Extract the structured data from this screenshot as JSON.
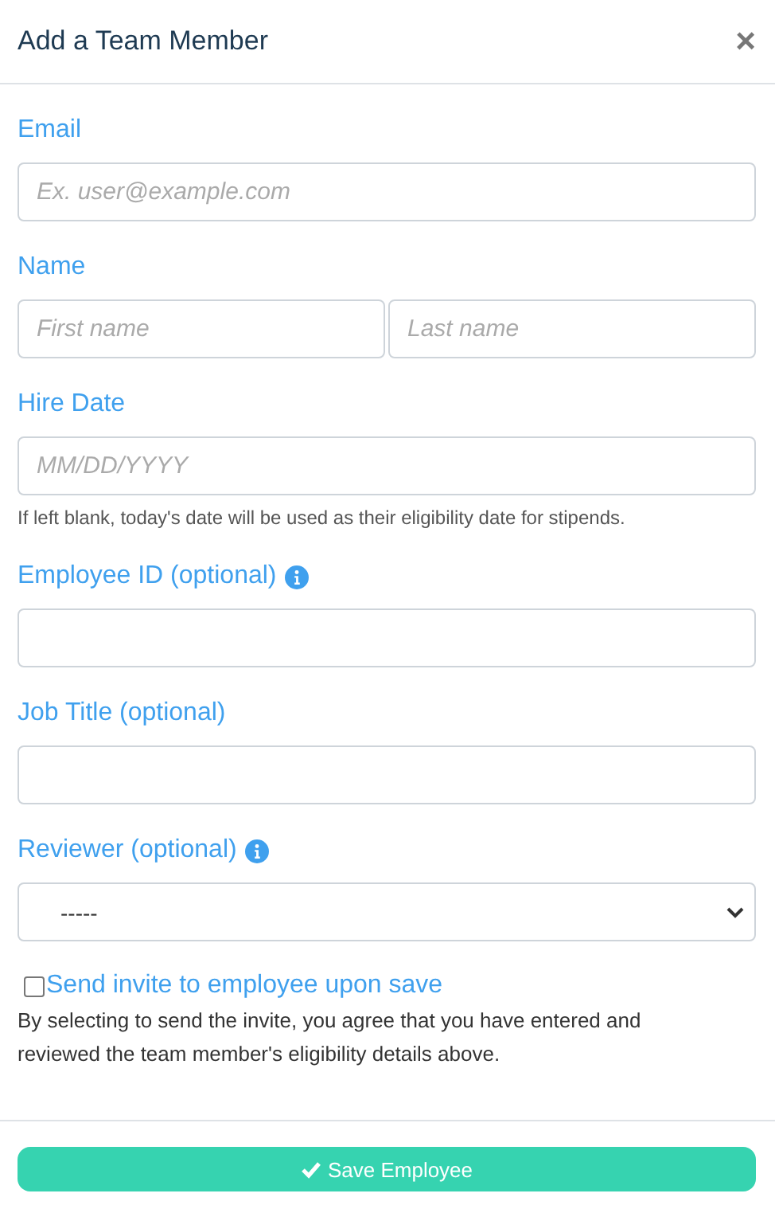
{
  "dialog": {
    "title": "Add a Team Member",
    "close": "×"
  },
  "fields": [
    {
      "kind": "text",
      "label": "Email",
      "info": false,
      "placeholder": "Ex. user@example.com"
    },
    {
      "kind": "name",
      "label": "Name",
      "info": false,
      "inputs": [
        {
          "placeholder": "First name"
        },
        {
          "placeholder": "Last name"
        }
      ]
    },
    {
      "kind": "text",
      "label": "Hire Date",
      "info": false,
      "placeholder": "MM/DD/YYYY",
      "help": "If left blank, today's date will be used as their eligibility date for stipends."
    },
    {
      "kind": "text",
      "label": "Employee ID (optional)",
      "info": true
    },
    {
      "kind": "text",
      "label": "Job Title (optional)",
      "info": false
    },
    {
      "kind": "select",
      "label": "Reviewer (optional)",
      "info": true,
      "value": "-----"
    }
  ],
  "invite": {
    "label": "Send invite to employee upon save",
    "checked": false,
    "note": "By selecting to send the invite, you agree that you have entered and reviewed the team member's eligibility details above."
  },
  "save_button": {
    "label": "Save Employee"
  }
}
